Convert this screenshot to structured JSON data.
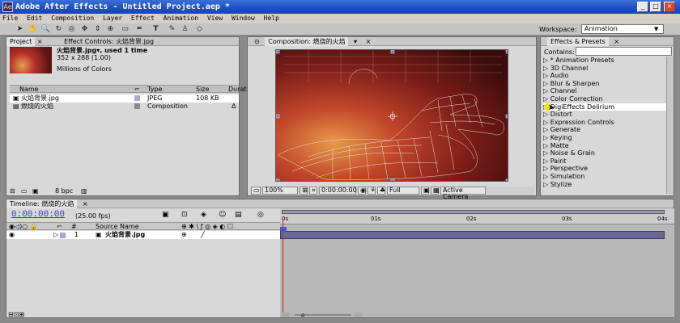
{
  "window": {
    "title": "Adobe After Effects - Untitled Project.aep *",
    "icon_letters": "Ae",
    "controls": [
      "_",
      "□",
      "×"
    ]
  },
  "menu": [
    "File",
    "Edit",
    "Composition",
    "Layer",
    "Effect",
    "Animation",
    "View",
    "Window",
    "Help"
  ],
  "toolbar": {
    "tools": [
      "selection-tool-icon",
      "hand-tool-icon",
      "zoom-tool-icon",
      "rotate-tool-icon",
      "orbit-camera-icon",
      "track-xy-camera-icon",
      "track-z-camera-icon",
      "pan-behind-icon",
      "rectangle-mask-icon",
      "pen-tool-icon",
      "type-tool-icon",
      "brush-tool-icon",
      "clone-stamp-icon",
      "eraser-icon"
    ],
    "type_glyph": "T",
    "workspace_label": "Workspace:",
    "workspace_value": "Animation"
  },
  "project": {
    "tabs": [
      "Project",
      "Effect Controls: 火焰背景.jpg"
    ],
    "item_name": "火焰背景.jpg▾, used 1 time",
    "item_size": "352 x 288 (1.00)",
    "item_colors": "Millions of Colors",
    "columns": [
      "Name",
      "Type",
      "Size",
      "Durat"
    ],
    "rows": [
      {
        "name": "火焰背景.jpg",
        "type": "JPEG",
        "size": "108 KB",
        "dur": "",
        "swatch": "#a8a8d8"
      },
      {
        "name": "燃烧的火焰",
        "type": "Composition",
        "size": "",
        "dur": "Δ",
        "swatch": "#888888"
      }
    ],
    "bpc": "8 bpc"
  },
  "composition": {
    "tab": "Composition: 燃烧的火焰",
    "zoom": "100%",
    "timecode": "0:00:00:00",
    "resolution": "Full",
    "camera": "Active Camera"
  },
  "effects": {
    "tab": "Effects & Presets",
    "contains_label": "Contains:",
    "items": [
      "* Animation Presets",
      "3D Channel",
      "Audio",
      "Blur & Sharpen",
      "Channel",
      "Color Correction",
      "DigiEffects Delirium",
      "Distort",
      "Expression Controls",
      "Generate",
      "Keying",
      "Matte",
      "Noise & Grain",
      "Paint",
      "Perspective",
      "Simulation",
      "Stylize"
    ]
  },
  "timeline": {
    "tab": "Timeline: 燃烧的火焰",
    "timecode": "0:00:00:00",
    "fps": "(25.00 fps)",
    "col_hash": "#",
    "col_source": "Source Name",
    "layer_num": "1",
    "layer_name": "火焰背景.jpg",
    "ruler": [
      "0s",
      "01s",
      "02s",
      "03s",
      "04s"
    ]
  },
  "colors": {
    "title_blue": "#1c4ec4",
    "timecode_blue": "#2a3fc0",
    "layer_bar": "#6a6898",
    "playhead": "#d02020"
  }
}
